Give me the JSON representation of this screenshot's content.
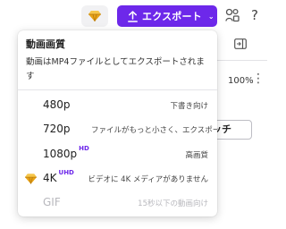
{
  "toolbar": {
    "export_label": "エクスポート",
    "premium_icon": "diamond-icon",
    "share_icon": "share-icon",
    "help_label": "?"
  },
  "side_panel": {
    "zoom_value": "100%",
    "button_label": "ッチ"
  },
  "export_menu": {
    "title": "動画画質",
    "description": "動画はMP4ファイルとしてエクスポートされます",
    "options": [
      {
        "label": "480p",
        "badge": "",
        "note": "下書き向け",
        "premium": false,
        "disabled": false
      },
      {
        "label": "720p",
        "badge": "",
        "note": "ファイルがもっと小さく、エクスポートが",
        "premium": false,
        "disabled": false
      },
      {
        "label": "1080p",
        "badge": "HD",
        "note": "高画質",
        "premium": false,
        "disabled": false
      },
      {
        "label": "4K",
        "badge": "UHD",
        "note": "ビデオに 4K メディアがありません",
        "premium": true,
        "disabled": false
      },
      {
        "label": "GIF",
        "badge": "",
        "note": "15秒以下の動画向け",
        "premium": false,
        "disabled": true
      }
    ]
  },
  "colors": {
    "accent": "#6d28ea",
    "premium": "#e8a317"
  }
}
